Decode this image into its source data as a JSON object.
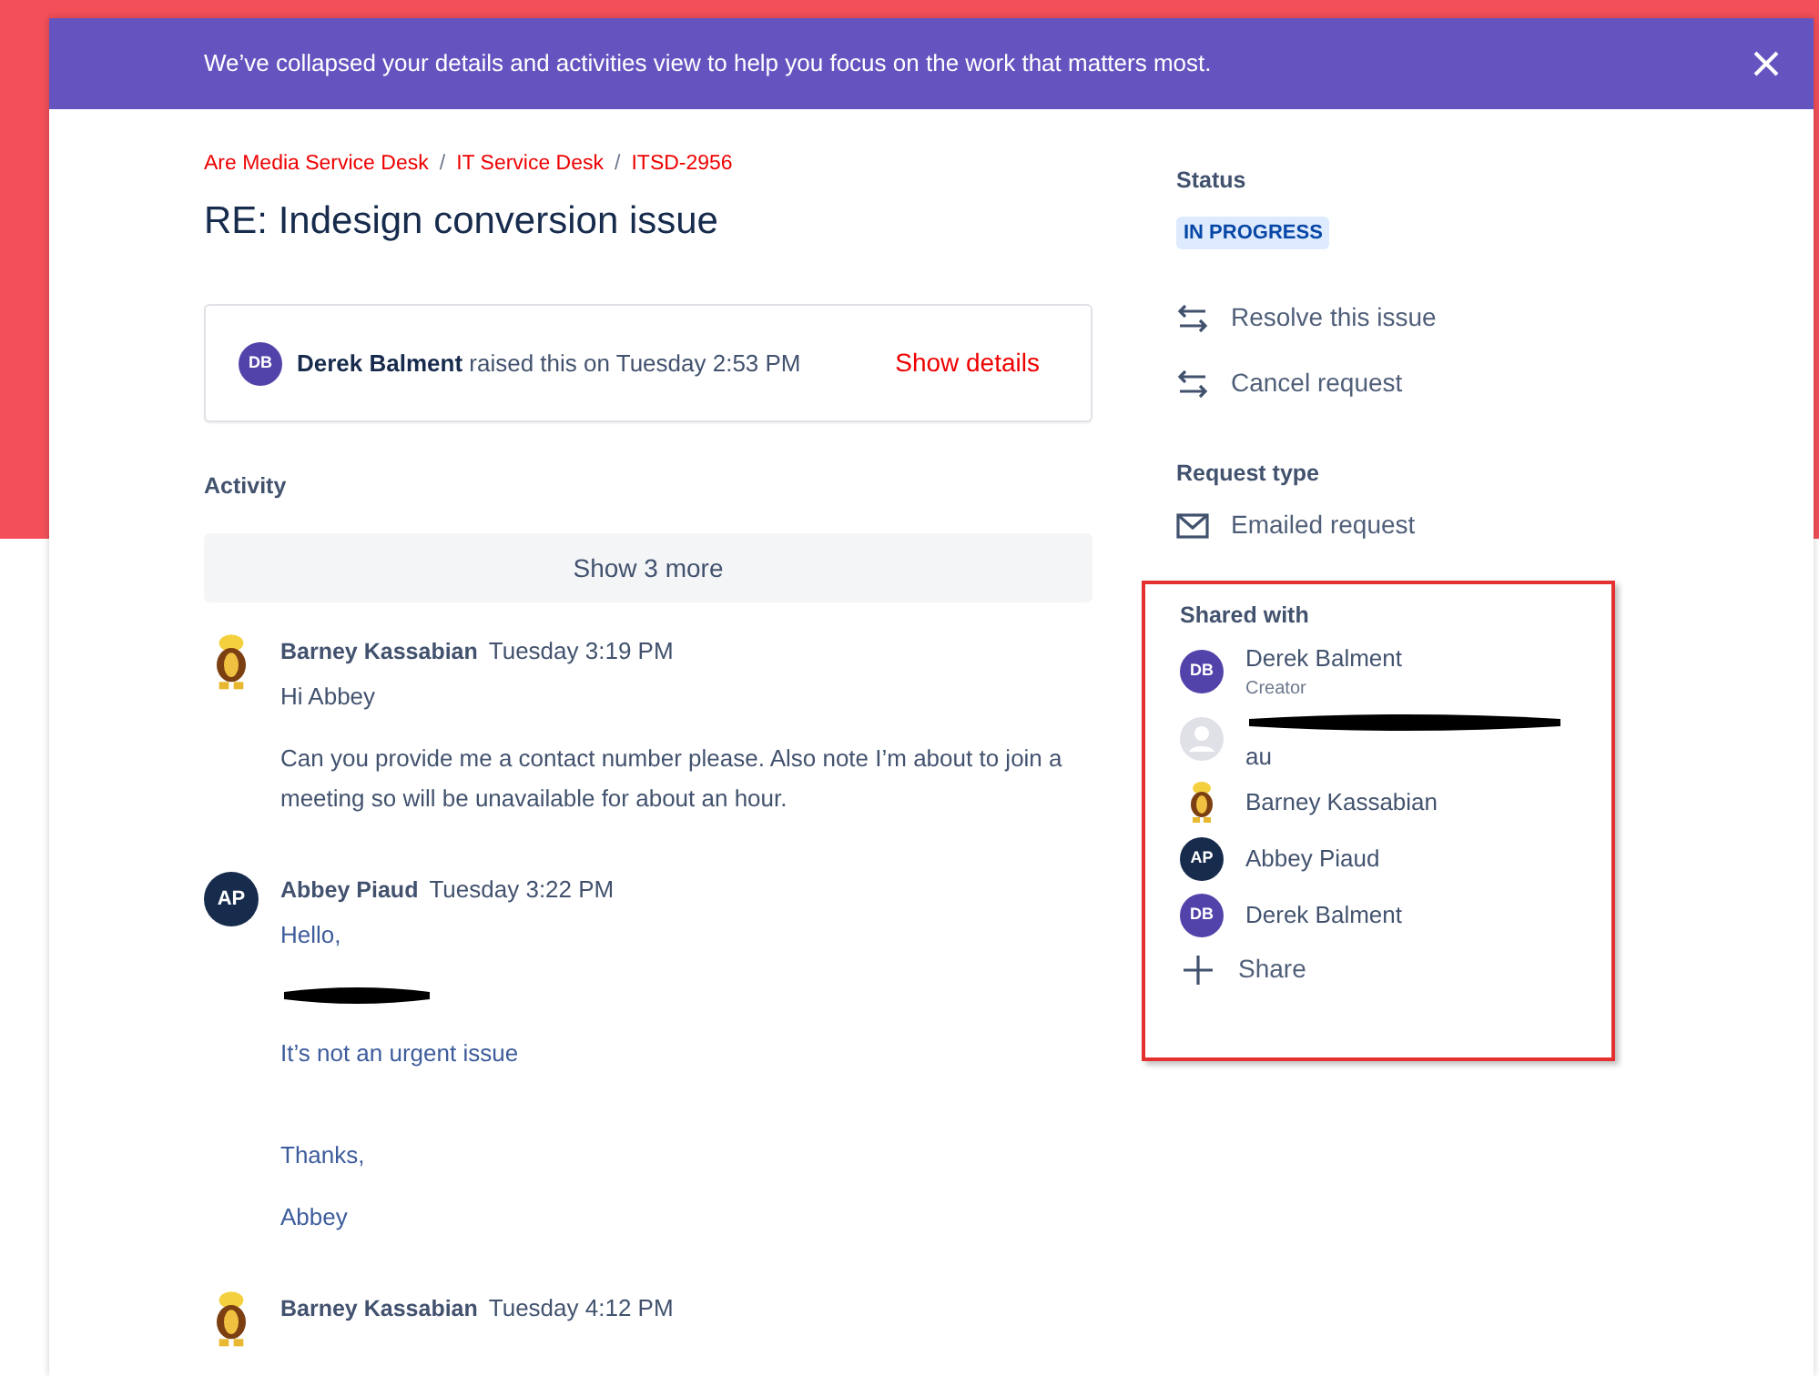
{
  "banner": {
    "text": "We’ve collapsed your details and activities view to help you focus on the work that matters most."
  },
  "breadcrumbs": {
    "separator": "/",
    "items": [
      "Are Media Service Desk",
      "IT Service Desk",
      "ITSD-2956"
    ]
  },
  "title": "RE: Indesign conversion issue",
  "raised": {
    "avatar": {
      "kind": "initials",
      "initials": "DB",
      "color": "#5243aa"
    },
    "text": "**Derek Balment** raised this on Tuesday 2:53 PM",
    "link": "Show details"
  },
  "activity": {
    "label": "Activity",
    "show_more": "Show 3 more",
    "comments": [
      {
        "kind": "portal",
        "avatar": {
          "kind": "cartoon"
        },
        "author": "Barney Kassabian",
        "time": "Tuesday 3:19 PM",
        "paragraphs": [
          {
            "kind": "text",
            "text": "Hi Abbey"
          },
          {
            "kind": "text",
            "text": "Can you provide me a contact number please.  Also note I’m about to join a meeting so will be unavailable for about an hour."
          }
        ]
      },
      {
        "kind": "email",
        "avatar": {
          "kind": "initials",
          "initials": "AP",
          "color": "#172b4d"
        },
        "author": "Abbey Piaud",
        "time": "Tuesday 3:22 PM",
        "paragraphs": [
          {
            "kind": "text",
            "text": "Hello,"
          },
          {
            "kind": "redacted"
          },
          {
            "kind": "text",
            "text": "It’s not an urgent issue"
          },
          {
            "kind": "blank"
          },
          {
            "kind": "text",
            "text": "Thanks,"
          },
          {
            "kind": "text",
            "text": "Abbey"
          }
        ]
      },
      {
        "kind": "portal",
        "avatar": {
          "kind": "cartoon"
        },
        "author": "Barney Kassabian",
        "time": "Tuesday 4:12 PM"
      }
    ]
  },
  "sidebar": {
    "status": {
      "label": "Status",
      "value": "IN PROGRESS"
    },
    "actions": [
      "Resolve this issue",
      "Cancel request"
    ],
    "request_type": {
      "label": "Request type",
      "value": "Emailed request"
    },
    "shared_with": {
      "label": "Shared with",
      "highlighted": true,
      "people": [
        {
          "avatar": {
            "kind": "initials",
            "initials": "DB",
            "color": "#5243aa"
          },
          "name": "Derek Balment",
          "role": "Creator"
        },
        {
          "avatar": {
            "kind": "default"
          },
          "redacted": true,
          "name": "au"
        },
        {
          "avatar": {
            "kind": "cartoon"
          },
          "name": "Barney Kassabian"
        },
        {
          "avatar": {
            "kind": "initials",
            "initials": "AP",
            "color": "#172b4d"
          },
          "name": "Abbey Piaud"
        },
        {
          "avatar": {
            "kind": "initials",
            "initials": "DB",
            "color": "#5243aa"
          },
          "name": "Derek Balment"
        }
      ],
      "share": "Share"
    }
  }
}
